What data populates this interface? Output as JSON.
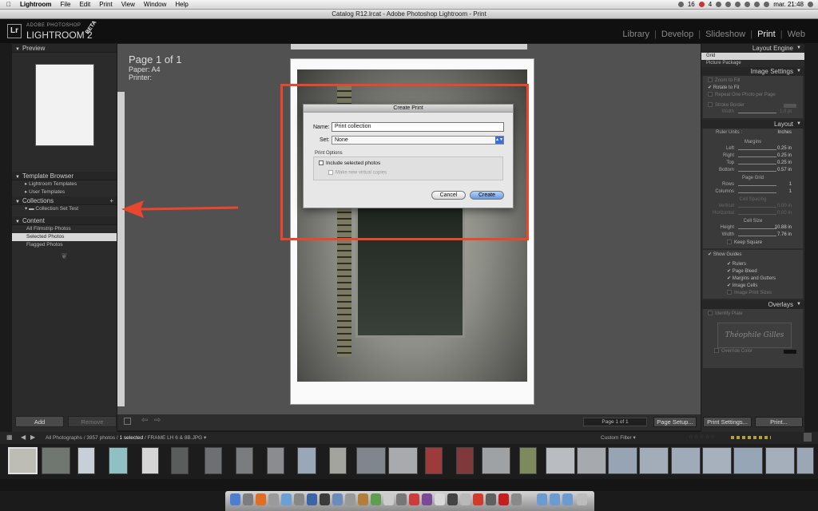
{
  "menubar": {
    "app": "Lightroom",
    "items": [
      "File",
      "Edit",
      "Print",
      "View",
      "Window",
      "Help"
    ],
    "status_clock": "mar. 21:48",
    "badge_a": "16",
    "badge_b": "4"
  },
  "window": {
    "title": "Catalog R12.lrcat - Adobe Photoshop Lightroom - Print"
  },
  "logo": {
    "badge": "Lr",
    "sub": "ADOBE PHOTOSHOP",
    "name": "LIGHTROOM 2",
    "beta": "BETA"
  },
  "modules": [
    "Library",
    "Develop",
    "Slideshow",
    "Print",
    "Web"
  ],
  "active_module": "Print",
  "left_panel": {
    "preview": "Preview",
    "template_browser": "Template Browser",
    "templates": [
      "Lightroom Templates",
      "User Templates"
    ],
    "collections": "Collections",
    "collections_plus": "+",
    "collection_item": "Collection Set Test",
    "content": "Content",
    "content_items": [
      "All Filmstrip Photos",
      "Selected Photos",
      "Flagged Photos"
    ],
    "selected_content": "Selected Photos",
    "add": "Add",
    "remove": "Remove"
  },
  "page_info": {
    "title": "Page 1 of 1",
    "paper": "Paper:  A4",
    "printer": "Printer:"
  },
  "dialog": {
    "title": "Create Print",
    "name_label": "Name:",
    "name_value": "Print collection",
    "set_label": "Set:",
    "set_value": "None",
    "options_label": "Print Options",
    "include_selected": "Include selected photos",
    "make_virtual": "Make new virtual copies",
    "cancel": "Cancel",
    "create": "Create"
  },
  "toolbar": {
    "page_count": "Page 1 of 1",
    "page_setup": "Page Setup...",
    "print_settings": "Print Settings...",
    "print": "Print..."
  },
  "right_panel": {
    "layout_engine": "Layout Engine",
    "engine_options": [
      "Grid",
      "Picture Package"
    ],
    "image_settings": "Image Settings",
    "zoom_to_fill": "Zoom to Fill",
    "rotate_to_fit": "Rotate to Fit",
    "repeat_one": "Repeat One Photo per Page",
    "stroke_border": "Stroke Border",
    "width_label": "Width",
    "stroke_width_value": "1.0 pt",
    "layout": "Layout",
    "ruler_units": "Ruler Units :",
    "ruler_units_value": "Inches",
    "margins": "Margins",
    "margin_rows": [
      {
        "label": "Left",
        "value": "0.25 in"
      },
      {
        "label": "Right",
        "value": "0.25 in"
      },
      {
        "label": "Top",
        "value": "0.25 in"
      },
      {
        "label": "Bottom",
        "value": "0.57 in"
      }
    ],
    "page_grid": "Page Grid",
    "grid_rows": [
      {
        "label": "Rows",
        "value": "1"
      },
      {
        "label": "Columns",
        "value": "1"
      }
    ],
    "cell_spacing": "Cell Spacing",
    "spacing_rows": [
      {
        "label": "Vertical",
        "value": "0.00 in"
      },
      {
        "label": "Horizontal",
        "value": "0.00 in"
      }
    ],
    "cell_size": "Cell Size",
    "size_rows": [
      {
        "label": "Height",
        "value": "10.88 in"
      },
      {
        "label": "Width",
        "value": "7.76 in"
      }
    ],
    "keep_square": "Keep Square",
    "show_guides": "Show Guides",
    "guides": [
      "Rulers",
      "Page Bleed",
      "Margins and Gutters",
      "Image Cells",
      "Image Print Sizes"
    ],
    "overlays": "Overlays",
    "identity_plate": "Identity Plate",
    "identity_text": "Théophile Gilles",
    "override_color": "Override Color"
  },
  "filmstrip": {
    "path_a": "All Photographs / 3957 photos /",
    "path_b": "1 selected",
    "path_c": "/ FRAME LH 6 & 8B.JPG",
    "filter": "Custom Filter"
  },
  "colors": {
    "accent": "#e8472e",
    "panel": "#2b2b2b",
    "canvas": "#515151"
  }
}
